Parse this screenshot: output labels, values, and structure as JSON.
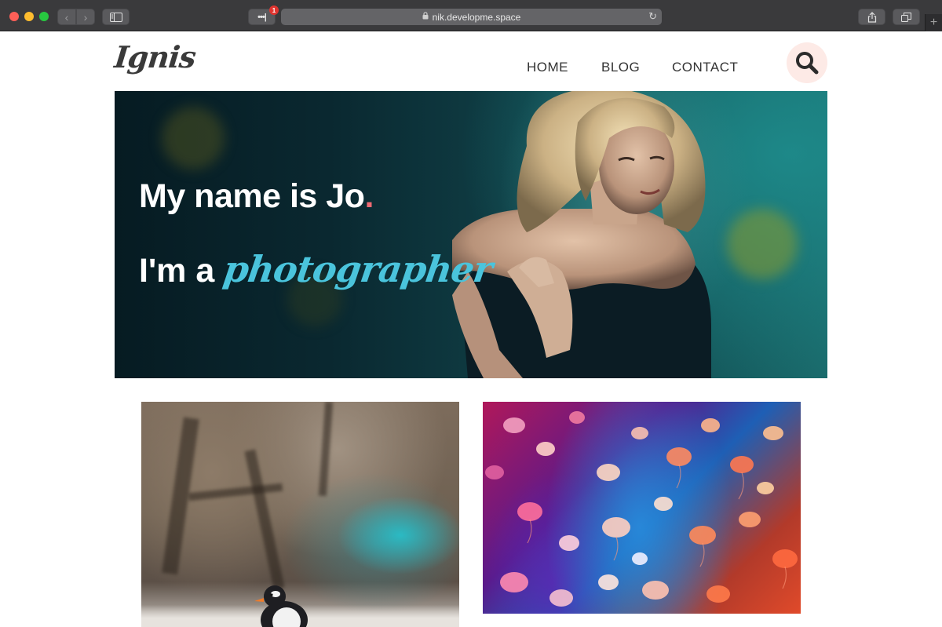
{
  "browser": {
    "url": "nik.developme.space",
    "extension_badge": "1",
    "extension_label": "•••|"
  },
  "site": {
    "logo": "Ignis",
    "nav": {
      "home": "HOME",
      "blog": "BLOG",
      "contact": "CONTACT"
    }
  },
  "hero": {
    "line1": "My name is Jo",
    "line1_dot": ".",
    "line2_prefix": "I'm a ",
    "line2_script": "photographer"
  },
  "gallery": {
    "items": [
      {
        "subject": "penguin-photo"
      },
      {
        "subject": "jellyfish-photo"
      }
    ]
  },
  "colors": {
    "accent_dot": "#f06a73",
    "script_text": "#4ac4dc",
    "search_bg": "#fdeae6",
    "browser_chrome": "#3a3a3c"
  }
}
